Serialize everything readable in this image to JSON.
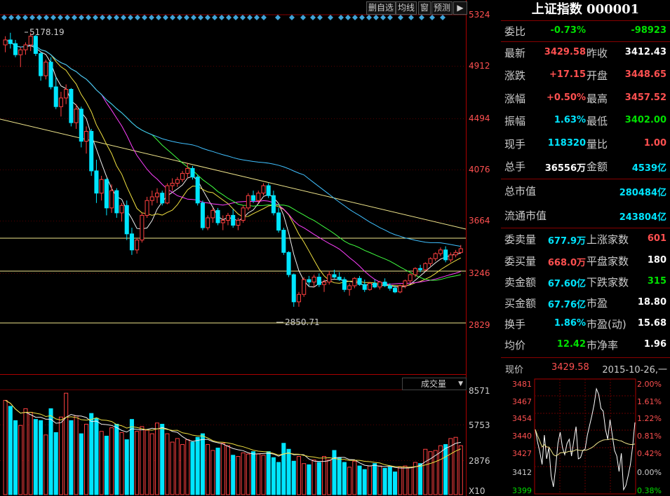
{
  "toolbar": {
    "delete_watch": "删自选",
    "ma_line": "均线",
    "window": "窗",
    "forecast": "预测",
    "next_icon": "next-arrow-icon"
  },
  "price_axis": [
    "5324",
    "4912",
    "4494",
    "4076",
    "3664",
    "3246",
    "2829"
  ],
  "volume_axis": [
    "8571",
    "5753",
    "2876"
  ],
  "volume_unit": "X10",
  "volume_select": {
    "label": "成交量"
  },
  "annotations": {
    "high": "5178.19",
    "low": "2850.71"
  },
  "quote": {
    "title": "上证指数 000001",
    "wei_bi_label": "委比",
    "wei_bi": "-0.73%",
    "wei_bi_diff": "-98923",
    "latest_label": "最新",
    "latest": "3429.58",
    "prev_close_label": "昨收",
    "prev_close": "3412.43",
    "change_label": "涨跌",
    "change": "+17.15",
    "open_label": "开盘",
    "open": "3448.65",
    "change_pct_label": "涨幅",
    "change_pct": "+0.50%",
    "high_label": "最高",
    "high": "3457.52",
    "amplitude_label": "振幅",
    "amplitude": "1.63%",
    "low_label": "最低",
    "low": "3402.00",
    "current_hand_label": "现手",
    "current_hand": "118320",
    "vol_ratio_label": "量比",
    "vol_ratio": "1.00",
    "total_hand_label": "总手",
    "total_hand": "36556万",
    "amount_label": "金额",
    "amount": "4539亿",
    "total_cap_label": "总市值",
    "total_cap": "280484亿",
    "float_cap_label": "流通市值",
    "float_cap": "243804亿",
    "ask_vol_label": "委卖量",
    "ask_vol": "677.9万",
    "up_count_label": "上涨家数",
    "up_count": "601",
    "bid_vol_label": "委买量",
    "bid_vol": "668.0万",
    "flat_count_label": "平盘家数",
    "flat_count": "180",
    "sell_amt_label": "卖金额",
    "sell_amt": "67.60亿",
    "down_count_label": "下跌家数",
    "down_count": "315",
    "buy_amt_label": "买金额",
    "buy_amt": "67.76亿",
    "pe_label": "市盈",
    "pe": "18.80",
    "turnover_label": "换手",
    "turnover": "1.86%",
    "pe_dyn_label": "市盈(动)",
    "pe_dyn": "15.68",
    "avg_price_label": "均价",
    "avg_price": "12.42",
    "pb_label": "市净率",
    "pb": "1.96"
  },
  "now": {
    "label": "现价",
    "price": "3429.58",
    "date": "2015-10-26,一"
  },
  "mini_axis_left": [
    "3481",
    "3467",
    "3454",
    "3440",
    "3427",
    "3412",
    "3399"
  ],
  "mini_axis_right": [
    "2.00%",
    "1.61%",
    "1.22%",
    "0.81%",
    "0.42%",
    "0.00%",
    "0.38%"
  ],
  "colors": {
    "up": "#ff4040",
    "down": "#00e5ff",
    "bg": "#000000",
    "grid": "#800000"
  },
  "chart_data": {
    "type": "candlestick",
    "ylim": [
      2829,
      5324
    ],
    "candles": [
      [
        5080,
        5150,
        5020,
        5120
      ],
      [
        5120,
        5178,
        5050,
        5090
      ],
      [
        5090,
        5120,
        4980,
        5000
      ],
      [
        5000,
        5060,
        4900,
        5040
      ],
      [
        5040,
        5100,
        5000,
        5080
      ],
      [
        5080,
        5178,
        5030,
        5150
      ],
      [
        5150,
        5160,
        4990,
        5010
      ],
      [
        5010,
        5020,
        4790,
        4830
      ],
      [
        4830,
        4960,
        4800,
        4940
      ],
      [
        4940,
        4980,
        4720,
        4740
      ],
      [
        4740,
        4820,
        4560,
        4580
      ],
      [
        4580,
        4700,
        4500,
        4650
      ],
      [
        4650,
        4760,
        4600,
        4720
      ],
      [
        4720,
        4730,
        4420,
        4450
      ],
      [
        4450,
        4600,
        4400,
        4560
      ],
      [
        4560,
        4580,
        4250,
        4300
      ],
      [
        4300,
        4420,
        4200,
        4380
      ],
      [
        4380,
        4400,
        4020,
        4060
      ],
      [
        4060,
        4150,
        3800,
        3880
      ],
      [
        3880,
        4020,
        3820,
        3990
      ],
      [
        3990,
        4000,
        3700,
        3760
      ],
      [
        3760,
        3950,
        3720,
        3900
      ],
      [
        3900,
        3920,
        3680,
        3720
      ],
      [
        3720,
        3800,
        3650,
        3780
      ],
      [
        3780,
        3820,
        3500,
        3550
      ],
      [
        3550,
        3600,
        3380,
        3420
      ],
      [
        3420,
        3520,
        3390,
        3500
      ],
      [
        3500,
        3720,
        3480,
        3700
      ],
      [
        3700,
        3850,
        3680,
        3820
      ],
      [
        3820,
        3900,
        3780,
        3850
      ],
      [
        3850,
        3920,
        3800,
        3880
      ],
      [
        3880,
        3900,
        3780,
        3800
      ],
      [
        3800,
        3960,
        3790,
        3940
      ],
      [
        3940,
        4000,
        3900,
        3960
      ],
      [
        3960,
        4010,
        3930,
        3990
      ],
      [
        3990,
        4060,
        3970,
        4040
      ],
      [
        4040,
        4120,
        4000,
        4080
      ],
      [
        4080,
        4100,
        3990,
        4010
      ],
      [
        4010,
        4030,
        3780,
        3800
      ],
      [
        3800,
        3820,
        3580,
        3600
      ],
      [
        3600,
        3700,
        3580,
        3680
      ],
      [
        3680,
        3760,
        3640,
        3740
      ],
      [
        3740,
        3760,
        3620,
        3640
      ],
      [
        3640,
        3700,
        3580,
        3660
      ],
      [
        3660,
        3720,
        3620,
        3700
      ],
      [
        3700,
        3750,
        3600,
        3620
      ],
      [
        3620,
        3680,
        3580,
        3660
      ],
      [
        3660,
        3780,
        3640,
        3760
      ],
      [
        3760,
        3880,
        3740,
        3860
      ],
      [
        3860,
        3900,
        3800,
        3820
      ],
      [
        3820,
        3900,
        3800,
        3880
      ],
      [
        3880,
        3960,
        3860,
        3940
      ],
      [
        3940,
        3960,
        3840,
        3860
      ],
      [
        3860,
        3900,
        3700,
        3720
      ],
      [
        3720,
        3760,
        3560,
        3580
      ],
      [
        3580,
        3600,
        3380,
        3400
      ],
      [
        3400,
        3410,
        3200,
        3220
      ],
      [
        3220,
        3230,
        2960,
        3000
      ],
      [
        3000,
        3080,
        2960,
        3060
      ],
      [
        3060,
        3200,
        3040,
        3180
      ],
      [
        3180,
        3210,
        3130,
        3160
      ],
      [
        3160,
        3220,
        3120,
        3200
      ],
      [
        3200,
        3230,
        3120,
        3140
      ],
      [
        3140,
        3180,
        3080,
        3160
      ],
      [
        3160,
        3250,
        3140,
        3220
      ],
      [
        3220,
        3260,
        3190,
        3200
      ],
      [
        3200,
        3240,
        3170,
        3180
      ],
      [
        3180,
        3200,
        3080,
        3100
      ],
      [
        3100,
        3150,
        3050,
        3130
      ],
      [
        3130,
        3200,
        3110,
        3190
      ],
      [
        3190,
        3210,
        3130,
        3140
      ],
      [
        3140,
        3180,
        3080,
        3100
      ],
      [
        3100,
        3160,
        3090,
        3150
      ],
      [
        3150,
        3180,
        3110,
        3120
      ],
      [
        3120,
        3170,
        3100,
        3160
      ],
      [
        3160,
        3190,
        3120,
        3130
      ],
      [
        3130,
        3150,
        3090,
        3110
      ],
      [
        3110,
        3130,
        3070,
        3080
      ],
      [
        3080,
        3140,
        3070,
        3130
      ],
      [
        3130,
        3180,
        3110,
        3170
      ],
      [
        3170,
        3230,
        3150,
        3220
      ],
      [
        3220,
        3280,
        3200,
        3270
      ],
      [
        3270,
        3300,
        3240,
        3260
      ],
      [
        3260,
        3320,
        3250,
        3310
      ],
      [
        3310,
        3360,
        3290,
        3350
      ],
      [
        3350,
        3400,
        3330,
        3390
      ],
      [
        3390,
        3440,
        3370,
        3420
      ],
      [
        3420,
        3450,
        3320,
        3340
      ],
      [
        3340,
        3400,
        3320,
        3380
      ],
      [
        3380,
        3420,
        3360,
        3400
      ],
      [
        3400,
        3460,
        3390,
        3430
      ]
    ],
    "volumes": [
      7900,
      7400,
      6200,
      5800,
      7200,
      6900,
      6300,
      6200,
      5000,
      7200,
      5200,
      6500,
      8500,
      6200,
      6600,
      5100,
      5900,
      6800,
      6400,
      5300,
      4900,
      5600,
      5900,
      5200,
      4600,
      6300,
      5300,
      5700,
      5400,
      5100,
      6000,
      5900,
      5100,
      4400,
      4700,
      4200,
      4600,
      4400,
      4800,
      5100,
      4200,
      3700,
      3900,
      4300,
      4100,
      3300,
      3200,
      3500,
      3400,
      3600,
      3400,
      3300,
      3600,
      3100,
      2700,
      4300,
      3800,
      2800,
      3200,
      2600,
      2500,
      2900,
      2700,
      3200,
      2900,
      3700,
      3100,
      2700,
      2300,
      2800,
      2400,
      2100,
      2400,
      2600,
      2400,
      2200,
      2300,
      1900,
      2300,
      2400,
      2300,
      2700,
      2600,
      3800,
      3600,
      3700,
      4100,
      4200,
      4700,
      4800,
      4100
    ]
  }
}
